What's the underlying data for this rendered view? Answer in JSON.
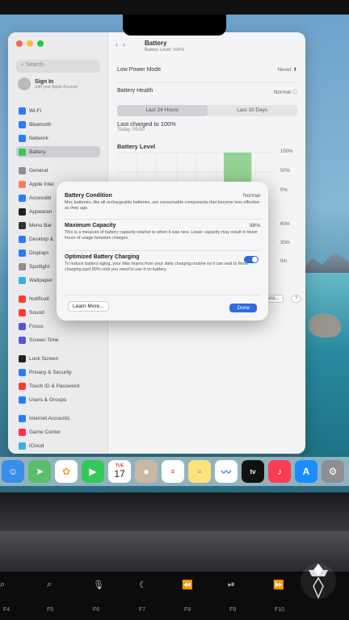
{
  "window": {
    "title": "Battery",
    "subtitle": "Battery Level: 100%",
    "search_placeholder": "Search",
    "sign_in": {
      "title": "Sign In",
      "subtitle": "with your Apple Account"
    }
  },
  "sidebar": {
    "items": [
      {
        "label": "Wi-Fi",
        "color": "#2d7cf6"
      },
      {
        "label": "Bluetooth",
        "color": "#2d7cf6"
      },
      {
        "label": "Network",
        "color": "#2d7cf6"
      },
      {
        "label": "Battery",
        "color": "#34c759",
        "selected": true
      },
      {
        "label": "General",
        "color": "#8e8e93"
      },
      {
        "label": "Apple Intel",
        "color": "#ff7a5c"
      },
      {
        "label": "Accessibi",
        "color": "#2d7cf6"
      },
      {
        "label": "Appearan",
        "color": "#222"
      },
      {
        "label": "Menu Bar",
        "color": "#333"
      },
      {
        "label": "Desktop &",
        "color": "#2d7cf6"
      },
      {
        "label": "Displays",
        "color": "#2d7cf6"
      },
      {
        "label": "Spotlight",
        "color": "#8e8e93"
      },
      {
        "label": "Wallpaper",
        "color": "#3ab0e0"
      },
      {
        "label": "Notificati",
        "color": "#ff3b30"
      },
      {
        "label": "Sound",
        "color": "#ff3b30"
      },
      {
        "label": "Focus",
        "color": "#5856d6"
      },
      {
        "label": "Screen Time",
        "color": "#5856d6"
      },
      {
        "label": "Lock Screen",
        "color": "#222"
      },
      {
        "label": "Privacy & Security",
        "color": "#2d7cf6"
      },
      {
        "label": "Touch ID & Password",
        "color": "#ff3b30"
      },
      {
        "label": "Users & Groups",
        "color": "#2d7cf6"
      },
      {
        "label": "Internet Accounts",
        "color": "#2d7cf6"
      },
      {
        "label": "Game Center",
        "color": "#ff2d55"
      },
      {
        "label": "iCloud",
        "color": "#3ab0e0"
      }
    ]
  },
  "main": {
    "low_power_mode": {
      "label": "Low Power Mode",
      "value": "Never"
    },
    "battery_health": {
      "label": "Battery Health",
      "value": "Normal"
    },
    "tabs": [
      "Last 24 Hours",
      "Last 10 Days"
    ],
    "last_charged": "Last charged to 100%",
    "last_charged_time": "Today, 09:50",
    "battery_level_title": "Battery Level",
    "options_button": "Options...",
    "help_button": "?"
  },
  "chart_data": {
    "type": "bar",
    "title": "Battery Level",
    "y_tick_labels": [
      "100%",
      "50%",
      "0%"
    ],
    "usage_tick_labels": [
      "60m",
      "30m",
      "0m"
    ],
    "ylim": [
      0,
      100
    ],
    "grid": true,
    "bars": [
      100
    ]
  },
  "dialog": {
    "condition_label": "Battery Condition",
    "condition_value": "Normal",
    "condition_desc": "Mac batteries, like all rechargeable batteries, are consumable components that become less effective as they age.",
    "capacity_label": "Maximum Capacity",
    "capacity_value": "88%",
    "capacity_desc": "This is a measure of battery capacity relative to when it was new. Lower capacity may result in fewer hours of usage between charges.",
    "optimized_label": "Optimized Battery Charging",
    "optimized_on": true,
    "optimized_desc": "To reduce battery aging, your Mac learns from your daily charging routine so it can wait to finish charging past 80% until you need to use it on battery.",
    "learn_more": "Learn More...",
    "done": "Done"
  },
  "dock": {
    "calendar_month": "TUE",
    "calendar_day": "17",
    "tv_label": "tv",
    "apps": [
      {
        "name": "finder-icon",
        "color": "#3a8de8"
      },
      {
        "name": "maps-icon",
        "color": "#5bbf6a"
      },
      {
        "name": "photos-icon",
        "color": "#ffffff"
      },
      {
        "name": "facetime-icon",
        "color": "#34c759"
      },
      {
        "name": "calendar-icon",
        "color": "#ffffff"
      },
      {
        "name": "contacts-icon",
        "color": "#c9b8a2"
      },
      {
        "name": "reminders-icon",
        "color": "#ffffff"
      },
      {
        "name": "notes-icon",
        "color": "#fbe37a"
      },
      {
        "name": "freeform-icon",
        "color": "#ffffff"
      },
      {
        "name": "tv-icon",
        "color": "#111111"
      },
      {
        "name": "music-icon",
        "color": "#fa3c52"
      },
      {
        "name": "app-store-icon",
        "color": "#1a8cff"
      },
      {
        "name": "settings-icon",
        "color": "#8e8e93"
      }
    ]
  },
  "keyboard": {
    "fkeys": [
      "F4",
      "F5",
      "F6",
      "F7",
      "F8",
      "F9",
      "F10"
    ]
  }
}
